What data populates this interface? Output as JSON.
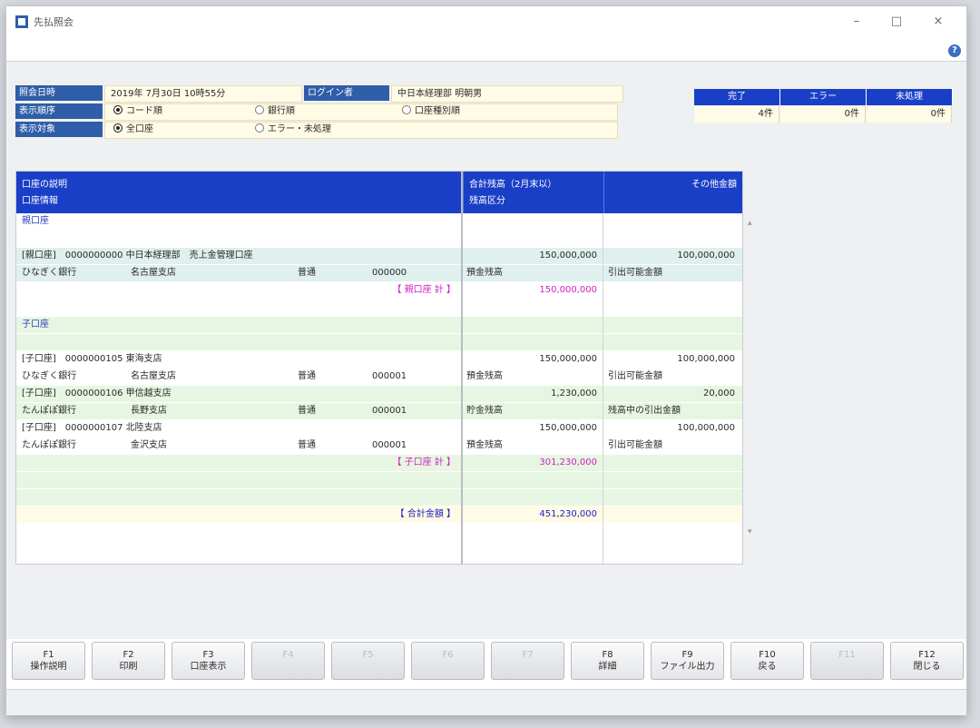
{
  "window": {
    "title": "先払照会",
    "minimize": "–",
    "maximize": "□",
    "close": "×"
  },
  "colors": {
    "accent": "#1a3fc7",
    "label_bg": "#2f5ea8",
    "value_bg": "#fffbe6",
    "subtotal_text": "#d020c0",
    "total_text": "#2020c0"
  },
  "conditions": {
    "row1": {
      "label": "照会日時",
      "value": "2019年 7月30日 10時55分",
      "label2": "ログイン者",
      "value2": "中日本経理部 明朝男"
    },
    "row2": {
      "label": "表示順序",
      "opt1": "コード順",
      "opt2": "銀行順",
      "opt3": "口座種別順"
    },
    "row3": {
      "label": "表示対象",
      "opt1": "全口座",
      "opt2": "エラー・未処理"
    }
  },
  "status": {
    "headers": [
      "完了",
      "エラー",
      "未処理"
    ],
    "values": [
      "4件",
      "0件",
      "0件"
    ]
  },
  "grid": {
    "headers": {
      "col1_line1": "口座の説明",
      "col1_line2": "口座情報",
      "col2_line1": "合計残高（2月末以）",
      "col2_line2": "残高区分",
      "col3_line1": "その他金額"
    },
    "rows": [
      {
        "type": "section",
        "text": "親口座"
      },
      {
        "type": "blank"
      },
      {
        "type": "data-a",
        "col1": "[親口座]　0000000000 中日本経理部　売上金管理口座",
        "col2": "150,000,000",
        "col3": "100,000,000"
      },
      {
        "type": "data-b",
        "a": "ひなぎく銀行",
        "b": "名古屋支店",
        "c": "普通",
        "d": "000000",
        "col2": "預金残高",
        "col3": "引出可能金額"
      },
      {
        "type": "subtotal",
        "label": "【 親口座 計 】",
        "col2": "150,000,000"
      },
      {
        "type": "blank"
      },
      {
        "type": "section-green",
        "text": "子口座"
      },
      {
        "type": "blank-green"
      },
      {
        "type": "data-w",
        "col1": "[子口座]　0000000105 東海支店",
        "col2": "150,000,000",
        "col3": "100,000,000"
      },
      {
        "type": "data-w2",
        "a": "ひなぎく銀行",
        "b": "名古屋支店",
        "c": "普通",
        "d": "000001",
        "col2": "預金残高",
        "col3": "引出可能金額"
      },
      {
        "type": "data-g",
        "col1": "[子口座]　0000000106 甲信越支店",
        "col2": "1,230,000",
        "col3": "20,000"
      },
      {
        "type": "data-g2",
        "a": "たんぽぽ銀行",
        "b": "長野支店",
        "c": "普通",
        "d": "000001",
        "col2": "貯金残高",
        "col3": "残高中の引出金額"
      },
      {
        "type": "data-w",
        "col1": "[子口座]　0000000107 北陸支店",
        "col2": "150,000,000",
        "col3": "100,000,000"
      },
      {
        "type": "data-w2",
        "a": "たんぽぽ銀行",
        "b": "金沢支店",
        "c": "普通",
        "d": "000001",
        "col2": "預金残高",
        "col3": "引出可能金額"
      },
      {
        "type": "subtotal-green",
        "label": "【 子口座 計 】",
        "col2": "301,230,000"
      },
      {
        "type": "blank-green"
      },
      {
        "type": "blank-green"
      },
      {
        "type": "total",
        "label": "【 合計金額 】",
        "col2": "451,230,000"
      }
    ]
  },
  "fkeys": [
    {
      "k": "F1",
      "t": "操作説明",
      "enabled": true
    },
    {
      "k": "F2",
      "t": "印刷",
      "enabled": true
    },
    {
      "k": "F3",
      "t": "口座表示",
      "enabled": true
    },
    {
      "k": "F4",
      "t": "",
      "enabled": false
    },
    {
      "k": "F5",
      "t": "",
      "enabled": false
    },
    {
      "k": "F6",
      "t": "",
      "enabled": false
    },
    {
      "k": "F7",
      "t": "",
      "enabled": false
    },
    {
      "k": "F8",
      "t": "詳細",
      "enabled": true
    },
    {
      "k": "F9",
      "t": "ファイル出力",
      "enabled": true
    },
    {
      "k": "F10",
      "t": "戻る",
      "enabled": true
    },
    {
      "k": "F11",
      "t": "",
      "enabled": false
    },
    {
      "k": "F12",
      "t": "閉じる",
      "enabled": true
    }
  ]
}
